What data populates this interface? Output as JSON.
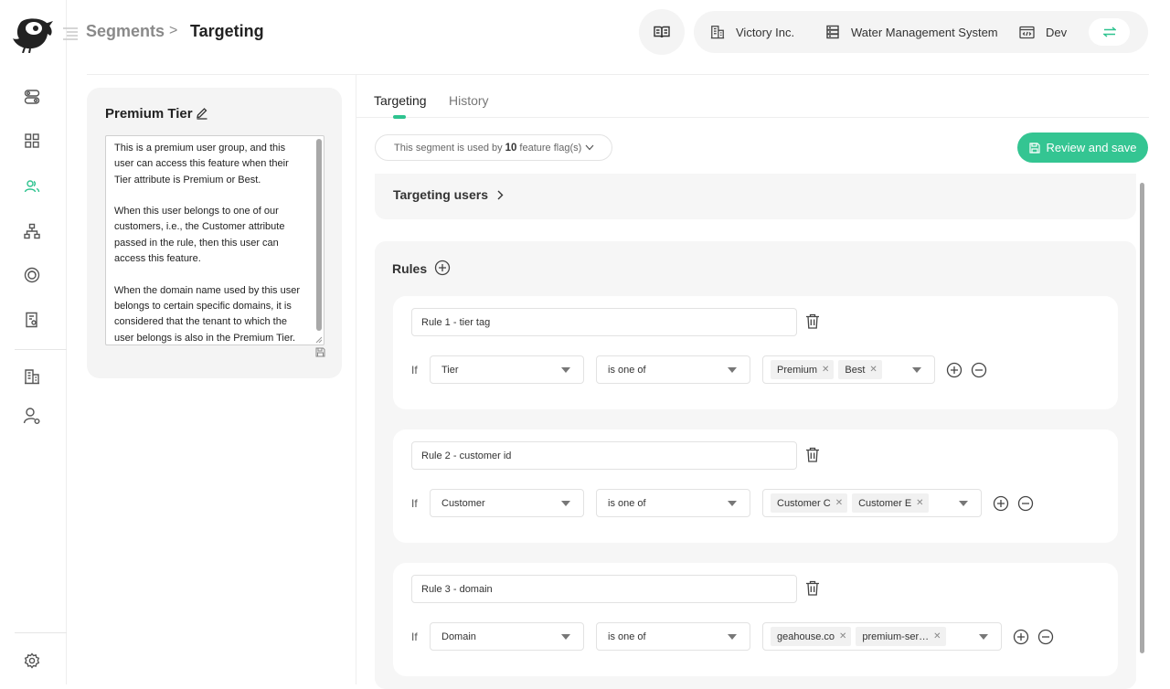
{
  "breadcrumb": {
    "root": "Segments",
    "separator": ">",
    "current": "Targeting"
  },
  "context": {
    "organization": "Victory Inc.",
    "project": "Water Management System",
    "environment": "Dev"
  },
  "icons": {
    "logo": "bird-logo-icon",
    "nav": [
      "toggles-icon",
      "grid-icon",
      "users-icon",
      "hierarchy-icon",
      "target-icon",
      "report-icon",
      "building-icon",
      "user-settings-icon",
      "settings-icon"
    ],
    "doc": "book-icon",
    "switch": "swap-icon"
  },
  "colors": {
    "accent": "#34c592",
    "active_nav": "#2ec38f"
  },
  "segment": {
    "name": "Premium Tier",
    "description": "This is a premium user group, and this user can access this feature when their Tier attribute is Premium or Best.\n\nWhen this user belongs to one of our customers, i.e., the Customer attribute passed in the rule, then this user can access this feature.\n\nWhen the domain name used by this user belongs to certain specific domains, it is considered that the tenant to which the user belongs is also in the Premium Tier."
  },
  "tabs": {
    "targeting": "Targeting",
    "history": "History",
    "active": "Targeting"
  },
  "usage": {
    "prefix": "This segment is used by",
    "count": "10",
    "suffix": "feature flag(s)"
  },
  "review_button": "Review and save",
  "targeting_users": {
    "label": "Targeting users"
  },
  "rules": {
    "title": "Rules",
    "items": [
      {
        "name": "Rule 1 - tier tag",
        "if_label": "If",
        "attribute": "Tier",
        "operator": "is one of",
        "values": [
          "Premium",
          "Best"
        ]
      },
      {
        "name": "Rule 2 - customer id",
        "if_label": "If",
        "attribute": "Customer",
        "operator": "is one of",
        "values": [
          "Customer C",
          "Customer E"
        ]
      },
      {
        "name": "Rule 3 - domain",
        "if_label": "If",
        "attribute": "Domain",
        "operator": "is one of",
        "values": [
          "geahouse.co",
          "premium-ser…"
        ]
      }
    ]
  }
}
